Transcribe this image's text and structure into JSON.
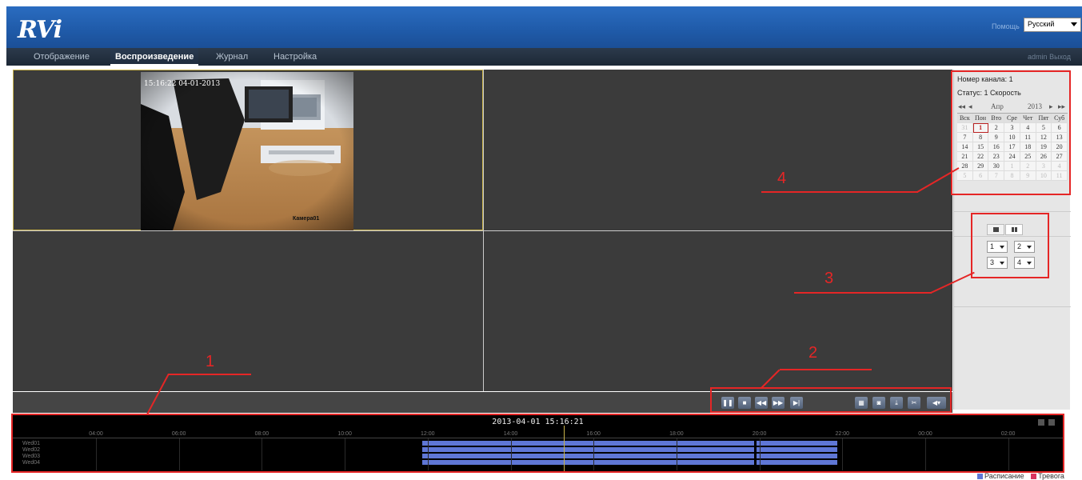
{
  "header": {
    "logo": "RVi",
    "help_link": "Помощь",
    "language": "Русский"
  },
  "nav": {
    "tabs": [
      {
        "label": "Отображение"
      },
      {
        "label": "Воспроизведение"
      },
      {
        "label": "Журнал"
      },
      {
        "label": "Настройка"
      }
    ],
    "user": "admin",
    "logout": "Выход"
  },
  "video": {
    "overlay_time": "15:16:22 04-01-2013",
    "camera_label": "Камера01"
  },
  "sidebar": {
    "channel_label": "Номер канала: 1",
    "status_label": "Статус: 1 Скорость",
    "calendar": {
      "month": "Апр",
      "year": "2013",
      "weekdays": [
        "Вск",
        "Пон",
        "Вто",
        "Сре",
        "Чет",
        "Пят",
        "Суб"
      ],
      "days": [
        [
          "31",
          "1",
          "2",
          "3",
          "4",
          "5",
          "6"
        ],
        [
          "7",
          "8",
          "9",
          "10",
          "11",
          "12",
          "13"
        ],
        [
          "14",
          "15",
          "16",
          "17",
          "18",
          "19",
          "20"
        ],
        [
          "21",
          "22",
          "23",
          "24",
          "25",
          "26",
          "27"
        ],
        [
          "28",
          "29",
          "30",
          "1",
          "2",
          "3",
          "4"
        ],
        [
          "5",
          "6",
          "7",
          "8",
          "9",
          "10",
          "11"
        ]
      ]
    },
    "channel_selects": [
      "1",
      "2",
      "3",
      "4"
    ]
  },
  "timeline": {
    "current_datetime": "2013-04-01 15:16:21",
    "ticks": [
      "04:00",
      "06:00",
      "08:00",
      "10:00",
      "12:00",
      "14:00",
      "16:00",
      "18:00",
      "20:00",
      "22:00",
      "00:00",
      "02:00"
    ],
    "rows": [
      "Wed01",
      "Wed02",
      "Wed03",
      "Wed04"
    ],
    "legend": {
      "schedule": "Расписание",
      "alarm": "Тревога"
    },
    "colors": {
      "schedule": "#5f77d6",
      "alarm": "#d8345f",
      "cursor": "#c8b24a"
    }
  },
  "annotations": [
    "1",
    "2",
    "3",
    "4"
  ]
}
